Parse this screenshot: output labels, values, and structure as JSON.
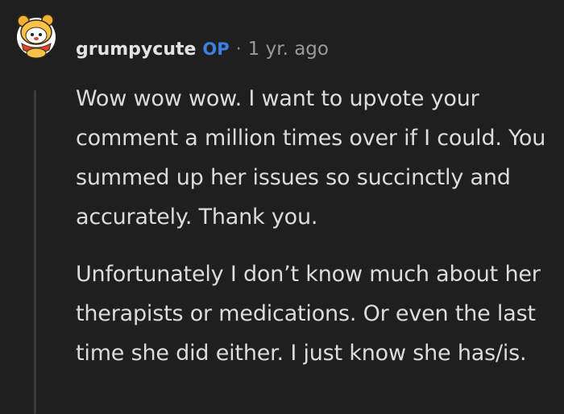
{
  "comment": {
    "author": "grumpycute",
    "badge": "OP",
    "separator": "·",
    "timestamp": "1 yr. ago",
    "avatar": {
      "icon": "snoo-avatar-icon"
    },
    "paragraphs": [
      "Wow wow wow. I want to upvote your comment a million times over if I could. You summed up her issues so succinctly and accurately. Thank you.",
      "Unfortunately I don’t know much about her therapists or medications. Or even the last time she did either. I just know she has/is."
    ]
  },
  "colors": {
    "background": "#1f1f1f",
    "op_badge": "#3d7fe0",
    "text": "#dcdcdc"
  }
}
